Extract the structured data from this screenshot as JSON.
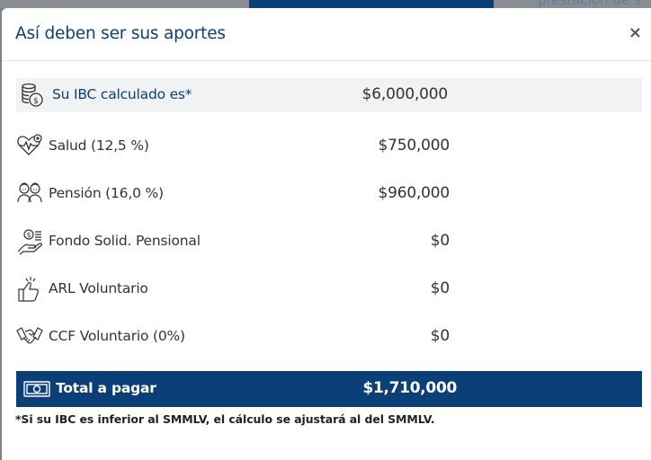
{
  "background": {
    "partial_text": "prestación de s"
  },
  "modal": {
    "title": "Así deben ser sus aportes",
    "close_label": "×",
    "ibc": {
      "label": "Su IBC calculado es*",
      "value": "$6,000,000",
      "icon": "coins-icon"
    },
    "rows": [
      {
        "label": "Salud (12,5 %)",
        "value": "$750,000",
        "icon": "heart-pulse-icon"
      },
      {
        "label": "Pensión (16,0 %)",
        "value": "$960,000",
        "icon": "elderly-couple-icon"
      },
      {
        "label": "Fondo Solid. Pensional",
        "value": "$0",
        "icon": "money-hand-icon"
      },
      {
        "label": "ARL Voluntario",
        "value": "$0",
        "icon": "thumbs-up-icon"
      },
      {
        "label": "CCF Voluntario (0%)",
        "value": "$0",
        "icon": "handshake-icon"
      }
    ],
    "total": {
      "label": "Total a pagar",
      "value": "$1,710,000",
      "icon": "cash-icon"
    },
    "footnote": "*Si su IBC es inferior al SMMLV, el cálculo se ajustará al del SMMLV."
  },
  "colors": {
    "brand_blue": "#0b3f78",
    "overlay": "#7f8288",
    "ibc_row_bg": "#f0f2f4"
  }
}
